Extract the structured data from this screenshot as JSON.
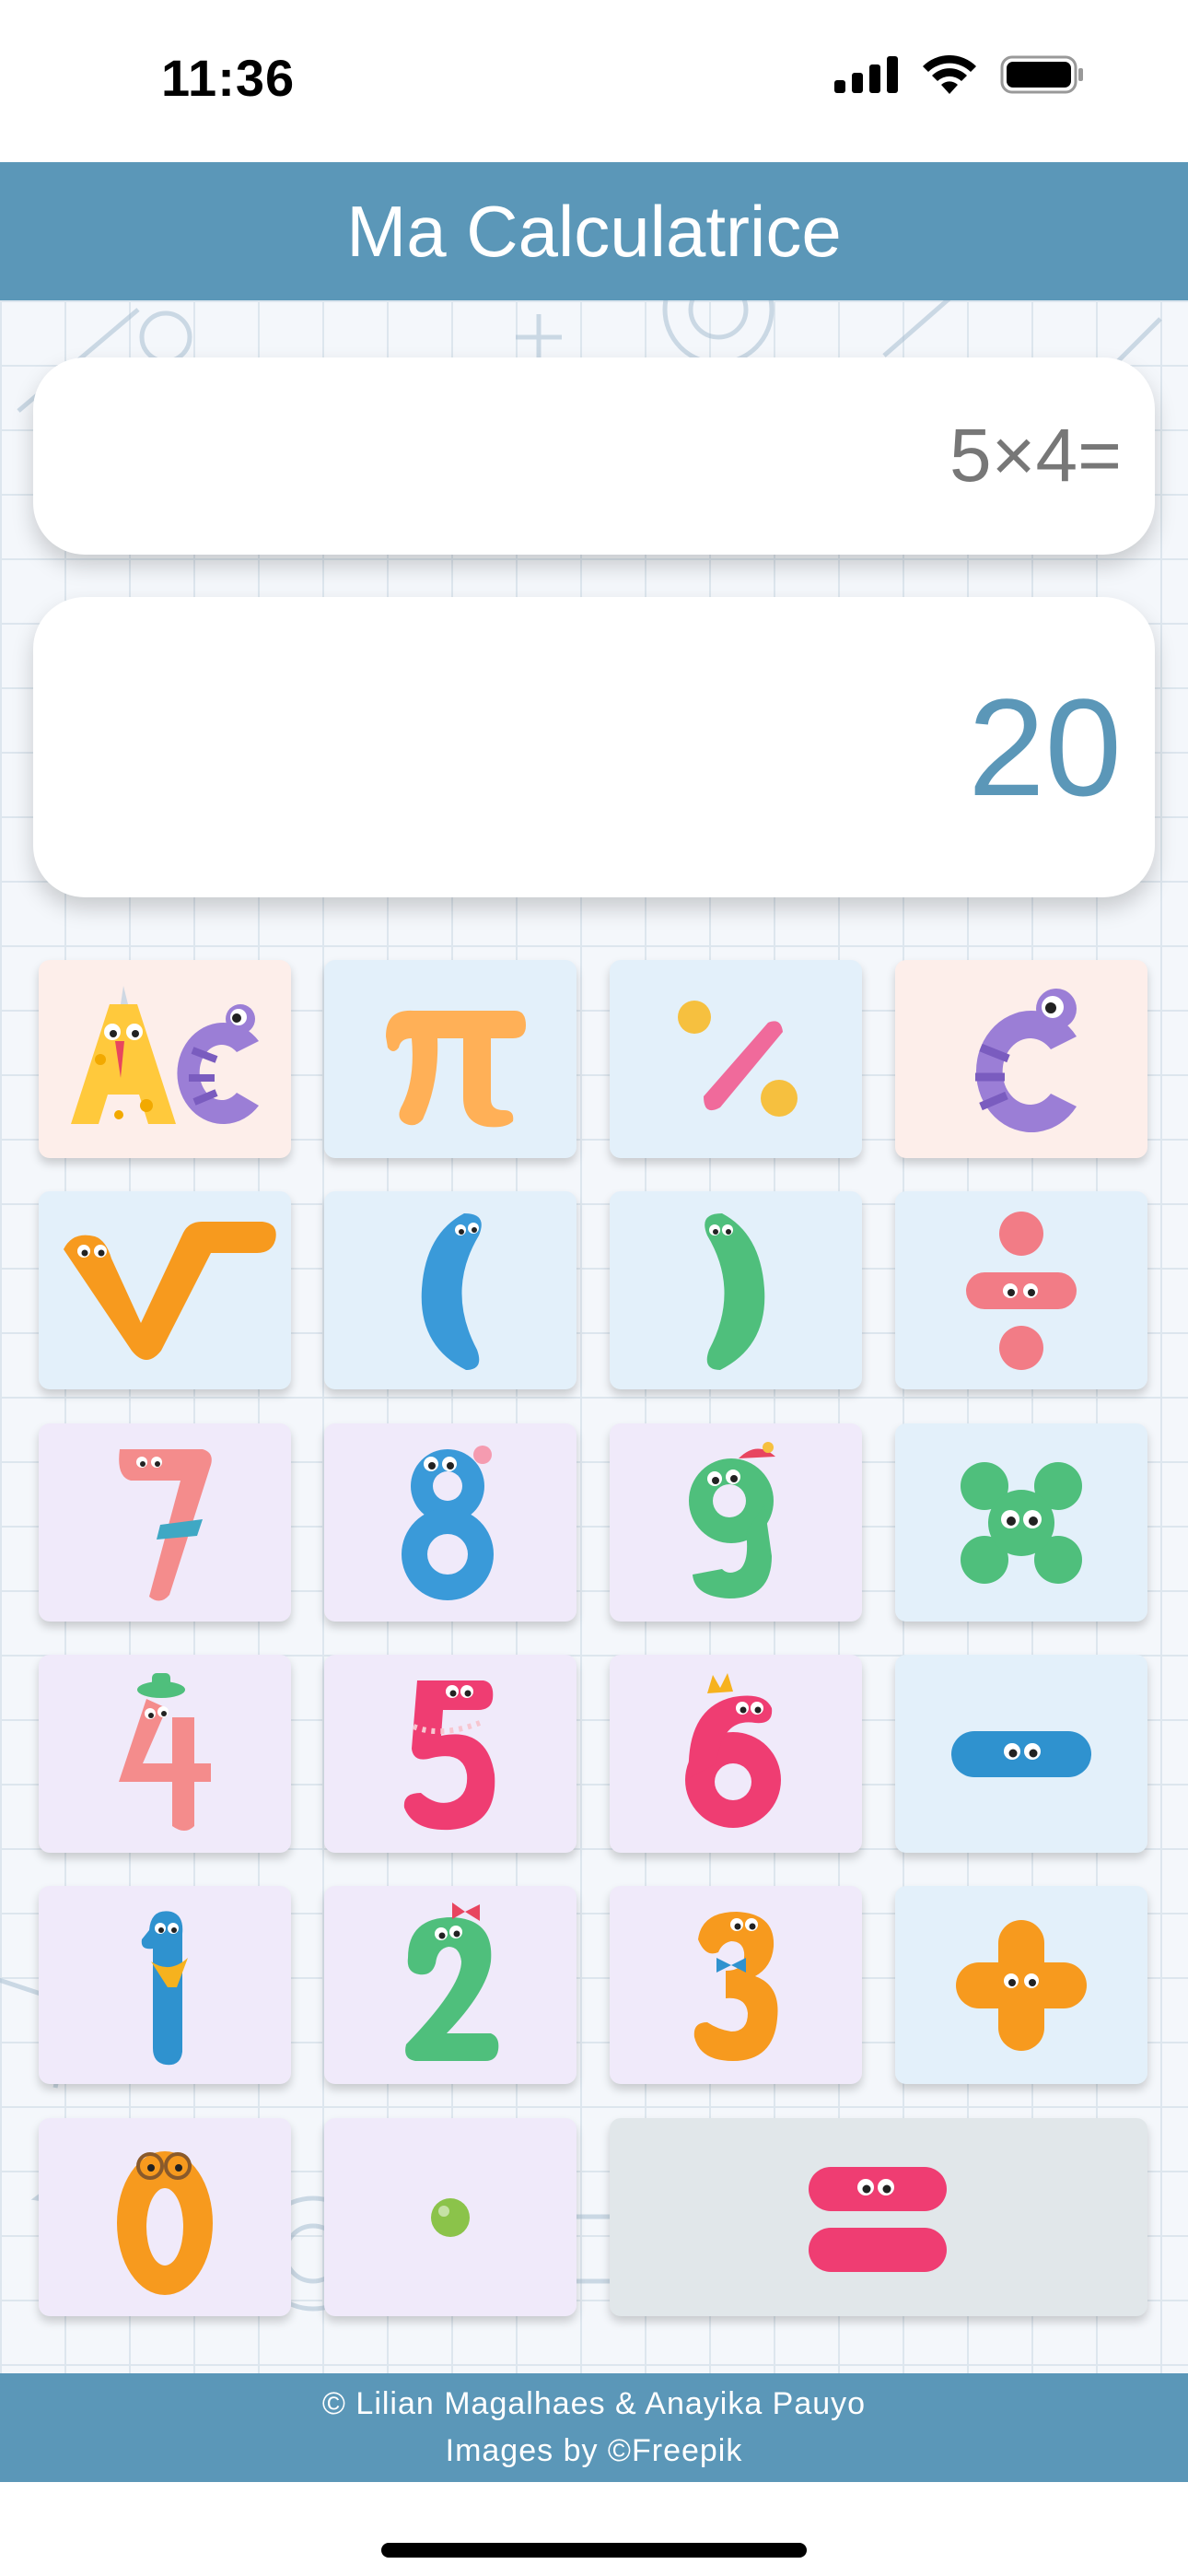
{
  "status_bar": {
    "time": "11:36"
  },
  "header": {
    "title": "Ma Calculatrice"
  },
  "display": {
    "expression": "5×4=",
    "result": "20"
  },
  "keys": [
    {
      "label": "AC",
      "color": "#fdeeea"
    },
    {
      "label": "π",
      "color": "#e3f0fa"
    },
    {
      "label": "%",
      "color": "#e3f0fa"
    },
    {
      "label": "C",
      "color": "#fdeeea"
    },
    {
      "label": "√",
      "color": "#e3f0fa"
    },
    {
      "label": "(",
      "color": "#e3f0fa"
    },
    {
      "label": ")",
      "color": "#e3f0fa"
    },
    {
      "label": "÷",
      "color": "#e3f0fa"
    },
    {
      "label": "7",
      "color": "#f0eafa"
    },
    {
      "label": "8",
      "color": "#f0eafa"
    },
    {
      "label": "9",
      "color": "#f0eafa"
    },
    {
      "label": "×",
      "color": "#e3f0fa"
    },
    {
      "label": "4",
      "color": "#f0eafa"
    },
    {
      "label": "5",
      "color": "#f0eafa"
    },
    {
      "label": "6",
      "color": "#f0eafa"
    },
    {
      "label": "−",
      "color": "#e3f0fa"
    },
    {
      "label": "1",
      "color": "#f0eafa"
    },
    {
      "label": "2",
      "color": "#f0eafa"
    },
    {
      "label": "3",
      "color": "#f0eafa"
    },
    {
      "label": "+",
      "color": "#e3f0fa"
    },
    {
      "label": "0",
      "color": "#f0eafa"
    },
    {
      "label": ".",
      "color": "#f0eafa"
    },
    {
      "label": "=",
      "color": "#e1e7ea"
    }
  ],
  "footer": {
    "credits": "© Lilian Magalhaes & Anayika Pauyo",
    "images": "Images by ©Freepik"
  },
  "colors": {
    "accent": "#5b97b8"
  }
}
